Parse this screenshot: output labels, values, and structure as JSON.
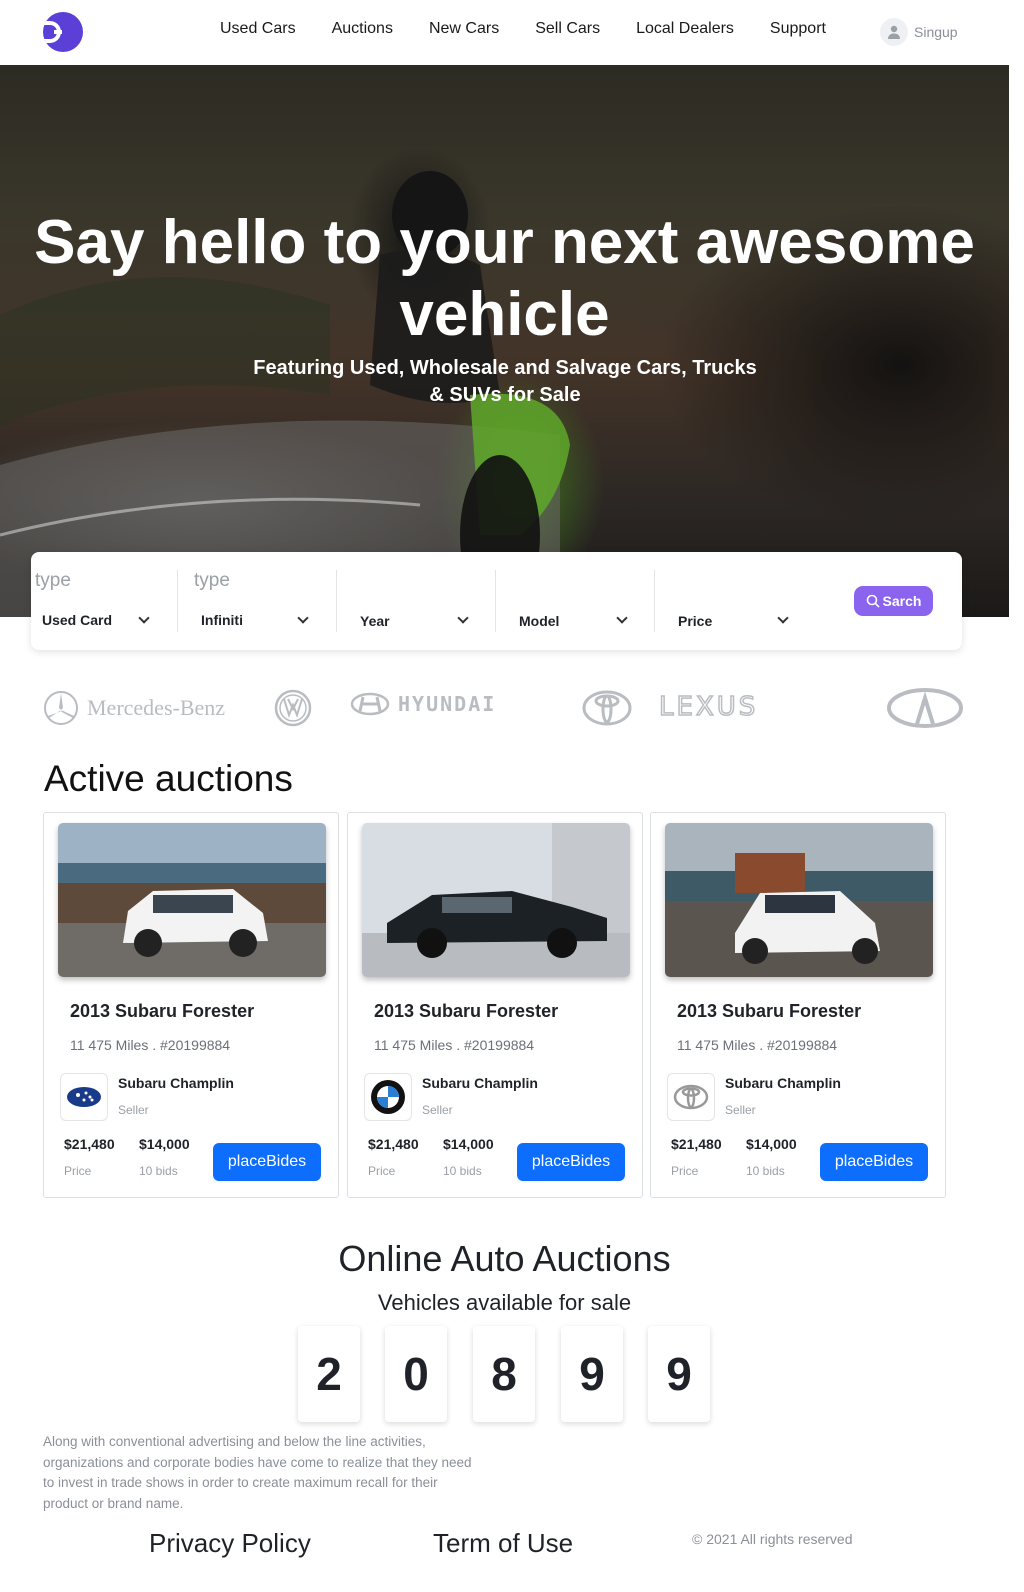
{
  "header": {
    "nav": [
      "Used Cars",
      "Auctions",
      "New Cars",
      "Sell Cars",
      "Local Dealers",
      "Support"
    ],
    "signup_label": "Singup"
  },
  "hero": {
    "title": "Say hello to your next awesome vehicle",
    "subtitle": "Featuring Used, Wholesale and Salvage Cars, Trucks & SUVs for Sale"
  },
  "search": {
    "fields": [
      {
        "placeholder": "type",
        "value": "Used Card"
      },
      {
        "placeholder": "type",
        "value": "Infiniti"
      },
      {
        "placeholder": "",
        "value": "Year"
      },
      {
        "placeholder": "",
        "value": "Model"
      },
      {
        "placeholder": "",
        "value": "Price"
      }
    ],
    "button_label": "Sarch"
  },
  "brands": [
    "Mercedes-Benz",
    "Volkswagen",
    "HYUNDAI",
    "Toyota",
    "LEXUS",
    "Infiniti"
  ],
  "brand_labels": {
    "mercedes": "Mercedes-Benz",
    "hyundai": "HYUNDAI",
    "lexus": "LEXUS"
  },
  "auctions": {
    "title": "Active auctions",
    "cards": [
      {
        "title": "2013 Subaru Forester",
        "meta": "11 475 Miles . #20199884",
        "seller": "Subaru Champlin",
        "seller_role": "Seller",
        "price": "$21,480",
        "price_label": "Price",
        "bid": "$14,000",
        "bid_label": "10 bids",
        "button": "placeBides",
        "seller_logo": "subaru-icon"
      },
      {
        "title": "2013 Subaru Forester",
        "meta": "11 475 Miles . #20199884",
        "seller": "Subaru Champlin",
        "seller_role": "Seller",
        "price": "$21,480",
        "price_label": "Price",
        "bid": "$14,000",
        "bid_label": "10 bids",
        "button": "placeBides",
        "seller_logo": "bmw-icon"
      },
      {
        "title": "2013 Subaru Forester",
        "meta": "11 475 Miles . #20199884",
        "seller": "Subaru Champlin",
        "seller_role": "Seller",
        "price": "$21,480",
        "price_label": "Price",
        "bid": "$14,000",
        "bid_label": "10 bids",
        "button": "placeBides",
        "seller_logo": "toyota-icon"
      }
    ]
  },
  "online": {
    "title": "Online Auto Auctions",
    "subtitle": "Vehicles available for sale",
    "digits": [
      "2",
      "0",
      "8",
      "9",
      "9"
    ]
  },
  "footer": {
    "about": "Along with conventional advertising and below the line activities, organizations and corporate bodies have come to realize that they need to invest in trade shows in order to create maximum recall for their product or brand name.",
    "privacy": "Privacy Policy",
    "terms": "Term of Use",
    "copyright": "© 2021 All rights reserved"
  },
  "colors": {
    "brand": "#5b3fd6",
    "search_button": "#8a63ef",
    "bid_button": "#0d6efd"
  }
}
